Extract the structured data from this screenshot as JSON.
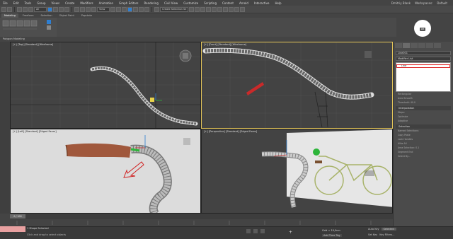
{
  "menu": {
    "items": [
      "File",
      "Edit",
      "Tools",
      "Group",
      "Views",
      "Create",
      "Modifiers",
      "Animation",
      "Graph Editors",
      "Rendering",
      "Civil View",
      "Customize",
      "Scripting",
      "Content",
      "Arnold",
      "Interactive",
      "Help"
    ],
    "user": "Dmitriy Blank",
    "workspaces_label": "Workspaces:",
    "workspace_value": "Default"
  },
  "toolbar": {
    "view_dropdown": "View",
    "selection_set": "Create Selection Se"
  },
  "ribbon": {
    "tabs": [
      "Modeling",
      "Freeform",
      "Selection",
      "Object Paint",
      "Populate"
    ],
    "panel_label": "Polygon Modeling"
  },
  "viewports": {
    "top_left": "[+] [Top] [Standard] [Wireframe]",
    "top_right": "[+] [Front] [Standard] [Wireframe]",
    "bottom_left": "[+] [Left] [Standard] [Edged Faces]",
    "bottom_right": "[+] [Perspective] [Standard] [Edged Faces]"
  },
  "nav": {
    "alt_label": "Alt"
  },
  "command_panel": {
    "object_name": "Line001",
    "modifier_list": "Modifier List",
    "modifier_item": "Line",
    "rectangular": "Rectangular",
    "auto_smooth": "Auto Smooth",
    "threshold_label": "Threshold:",
    "threshold_value": "40.0",
    "interpolation": "Interpolation",
    "steps": "Steps:",
    "optimize": "Optimize",
    "adaptive": "Adaptive",
    "selection": "Selection",
    "named_selections": "Named Selections:",
    "copy": "Copy",
    "paste": "Paste",
    "lock_handles": "Lock Handles",
    "alike": "Alike",
    "all": "All",
    "area_selection": "Area Selection:",
    "area_value": "0.1",
    "segment_end": "Segment End",
    "select_by": "Select By..."
  },
  "timeline": {
    "frame": "0 / 100"
  },
  "status": {
    "selected": "1 Shape Selected",
    "hint": "Click and drag to select objects",
    "grid": "Grid = 10,0cm",
    "add_time_tag": "Add Time Tag",
    "auto_key": "Auto Key",
    "set_key": "Set Key",
    "selected_dd": "Selected",
    "key_filters": "Key Filters..."
  },
  "colors": {
    "accent_blue": "#2d7fd3",
    "highlight_red": "#e03030",
    "active_viewport": "#e6c75a"
  }
}
